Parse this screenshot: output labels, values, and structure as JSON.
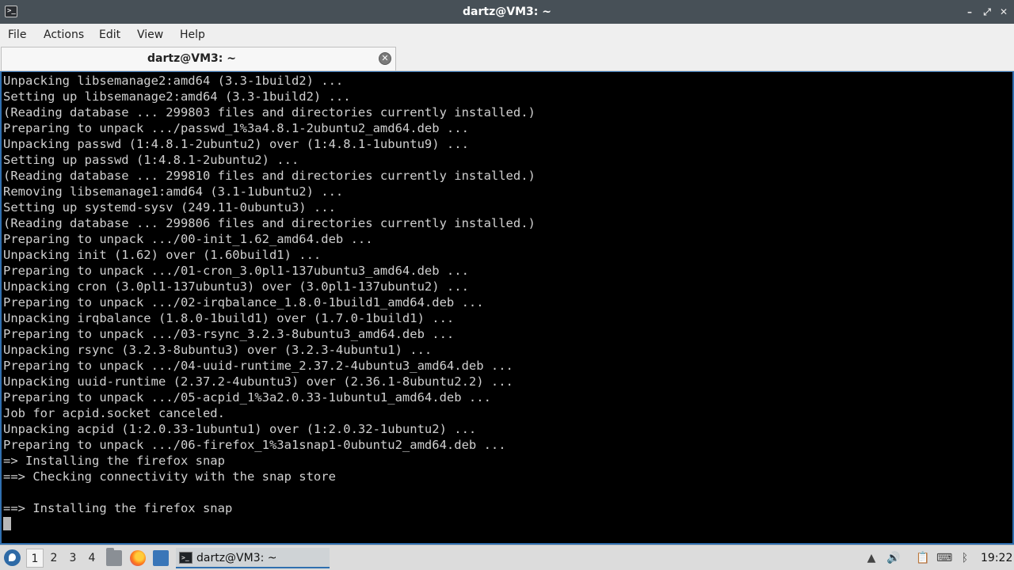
{
  "window": {
    "title": "dartz@VM3: ~",
    "app_icon_glyph": ">_",
    "buttons": {
      "minimize": "–",
      "maximize": "⤢",
      "close": "✕"
    }
  },
  "menu": [
    "File",
    "Actions",
    "Edit",
    "View",
    "Help"
  ],
  "tab": {
    "label": "dartz@VM3: ~",
    "close_glyph": "✕"
  },
  "terminal": {
    "lines": [
      "Unpacking libsemanage2:amd64 (3.3-1build2) ...",
      "Setting up libsemanage2:amd64 (3.3-1build2) ...",
      "(Reading database ... 299803 files and directories currently installed.)",
      "Preparing to unpack .../passwd_1%3a4.8.1-2ubuntu2_amd64.deb ...",
      "Unpacking passwd (1:4.8.1-2ubuntu2) over (1:4.8.1-1ubuntu9) ...",
      "Setting up passwd (1:4.8.1-2ubuntu2) ...",
      "(Reading database ... 299810 files and directories currently installed.)",
      "Removing libsemanage1:amd64 (3.1-1ubuntu2) ...",
      "Setting up systemd-sysv (249.11-0ubuntu3) ...",
      "(Reading database ... 299806 files and directories currently installed.)",
      "Preparing to unpack .../00-init_1.62_amd64.deb ...",
      "Unpacking init (1.62) over (1.60build1) ...",
      "Preparing to unpack .../01-cron_3.0pl1-137ubuntu3_amd64.deb ...",
      "Unpacking cron (3.0pl1-137ubuntu3) over (3.0pl1-137ubuntu2) ...",
      "Preparing to unpack .../02-irqbalance_1.8.0-1build1_amd64.deb ...",
      "Unpacking irqbalance (1.8.0-1build1) over (1.7.0-1build1) ...",
      "Preparing to unpack .../03-rsync_3.2.3-8ubuntu3_amd64.deb ...",
      "Unpacking rsync (3.2.3-8ubuntu3) over (3.2.3-4ubuntu1) ...",
      "Preparing to unpack .../04-uuid-runtime_2.37.2-4ubuntu3_amd64.deb ...",
      "Unpacking uuid-runtime (2.37.2-4ubuntu3) over (2.36.1-8ubuntu2.2) ...",
      "Preparing to unpack .../05-acpid_1%3a2.0.33-1ubuntu1_amd64.deb ...",
      "Job for acpid.socket canceled.",
      "Unpacking acpid (1:2.0.33-1ubuntu1) over (1:2.0.32-1ubuntu2) ...",
      "Preparing to unpack .../06-firefox_1%3a1snap1-0ubuntu2_amd64.deb ...",
      "=> Installing the firefox snap",
      "==> Checking connectivity with the snap store",
      "",
      "==> Installing the firefox snap"
    ]
  },
  "taskbar": {
    "workspaces": [
      "1",
      "2",
      "3",
      "4"
    ],
    "active_workspace": "1",
    "task_label": "dartz@VM3: ~",
    "clock": "19:22",
    "tray_glyphs": {
      "up": "▲",
      "volume": "🔊",
      "clipboard": "📋",
      "network": "⌨",
      "bluetooth": "ᛒ"
    }
  },
  "colors": {
    "titlebar": "#475057",
    "terminal_bg": "#000000",
    "terminal_fg": "#d0d0d0",
    "focus_border": "#2f6fb0",
    "panel": "#dcdcdc"
  }
}
